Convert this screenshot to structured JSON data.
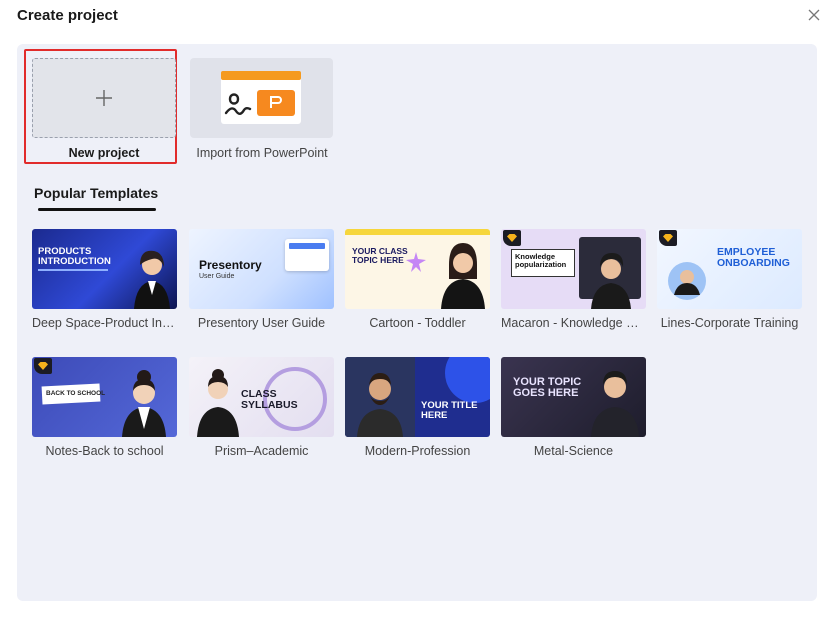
{
  "dialog": {
    "title": "Create project",
    "close_icon": "close-icon"
  },
  "top": {
    "new_project_label": "New project",
    "import_label": "Import from PowerPoint"
  },
  "section": {
    "title": "Popular Templates"
  },
  "templates": [
    {
      "label": "Deep Space-Product Intr...",
      "premium": false,
      "thumb_title": "PRODUCTS INTRODUCTION"
    },
    {
      "label": "Presentory User Guide",
      "premium": false,
      "thumb_title": "Presentory",
      "thumb_sub": "User Guide"
    },
    {
      "label": "Cartoon - Toddler",
      "premium": false,
      "thumb_title": "YOUR CLASS TOPIC HERE"
    },
    {
      "label": "Macaron - Knowledge Sh...",
      "premium": true,
      "thumb_title": "Knowledge popularization"
    },
    {
      "label": "Lines-Corporate Training",
      "premium": true,
      "thumb_title": "EMPLOYEE ONBOARDING"
    },
    {
      "label": "Notes-Back to school",
      "premium": true,
      "thumb_title": "BACK TO SCHOOL"
    },
    {
      "label": "Prism–Academic",
      "premium": false,
      "thumb_title": "CLASS SYLLABUS"
    },
    {
      "label": "Modern-Profession",
      "premium": true,
      "thumb_title": "YOUR TITLE HERE"
    },
    {
      "label": "Metal-Science",
      "premium": false,
      "thumb_title": "YOUR TOPIC GOES HERE"
    }
  ]
}
